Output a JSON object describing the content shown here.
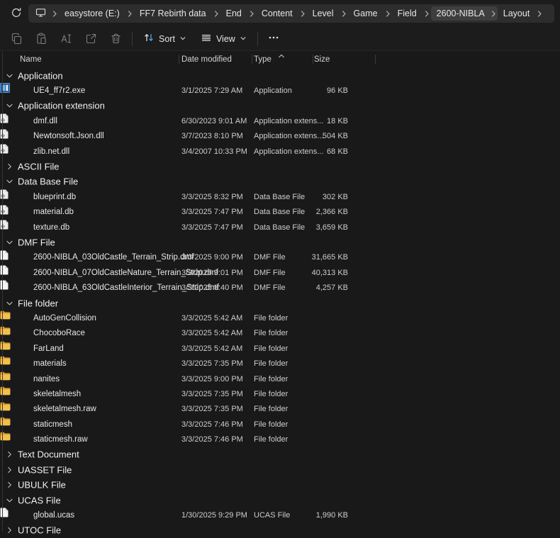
{
  "address_bar": {
    "refresh_icon": "refresh-icon",
    "device_icon": "monitor-icon",
    "breadcrumbs": [
      "easystore (E:)",
      "FF7 Rebirth data",
      "End",
      "Content",
      "Level",
      "Game",
      "Field",
      "2600-NIBLA",
      "Layout"
    ],
    "highlighted": "2600-NIBLA"
  },
  "toolbar": {
    "buttons": [
      {
        "icon": "copy-icon",
        "enabled": false
      },
      {
        "icon": "paste-icon",
        "enabled": false
      },
      {
        "icon": "rename-icon",
        "enabled": false
      },
      {
        "icon": "share-icon",
        "enabled": false
      },
      {
        "icon": "delete-icon",
        "enabled": false
      }
    ],
    "sort_label": "Sort",
    "view_label": "View",
    "more_icon": "more-options-icon"
  },
  "columns": {
    "name": "Name",
    "date_modified": "Date modified",
    "type": "Type",
    "size": "Size",
    "sorted_by": "Type",
    "sort_direction": "ascending"
  },
  "file_list": {
    "groups": [
      {
        "label": "Application",
        "expanded": true,
        "items": [
          {
            "icon": "application",
            "name": "UE4_ff7r2.exe",
            "date_modified": "3/1/2025 7:29 AM",
            "type": "Application",
            "size": "96 KB"
          }
        ]
      },
      {
        "label": "Application extension",
        "expanded": true,
        "items": [
          {
            "icon": "dll",
            "name": "dmf.dll",
            "date_modified": "6/30/2023 9:01 AM",
            "type": "Application extens...",
            "size": "18 KB"
          },
          {
            "icon": "dll",
            "name": "Newtonsoft.Json.dll",
            "date_modified": "3/7/2023 8:10 PM",
            "type": "Application extens...",
            "size": "504 KB"
          },
          {
            "icon": "dll",
            "name": "zlib.net.dll",
            "date_modified": "3/4/2007 10:33 PM",
            "type": "Application extens...",
            "size": "68 KB"
          }
        ]
      },
      {
        "label": "ASCII File",
        "expanded": false,
        "items": []
      },
      {
        "label": "Data Base File",
        "expanded": true,
        "items": [
          {
            "icon": "database",
            "name": "blueprint.db",
            "date_modified": "3/3/2025 8:32 PM",
            "type": "Data Base File",
            "size": "302 KB"
          },
          {
            "icon": "database",
            "name": "material.db",
            "date_modified": "3/3/2025 7:47 PM",
            "type": "Data Base File",
            "size": "2,366 KB"
          },
          {
            "icon": "database",
            "name": "texture.db",
            "date_modified": "3/3/2025 7:47 PM",
            "type": "Data Base File",
            "size": "3,659 KB"
          }
        ]
      },
      {
        "label": "DMF File",
        "expanded": true,
        "items": [
          {
            "icon": "file",
            "name": "2600-NIBLA_03OldCastle_Terrain_Strip.dmf",
            "date_modified": "3/3/2025 9:00 PM",
            "type": "DMF File",
            "size": "31,665 KB"
          },
          {
            "icon": "file",
            "name": "2600-NIBLA_07OldCastleNature_Terrain_Strip.dmf",
            "date_modified": "3/3/2025 9:01 PM",
            "type": "DMF File",
            "size": "40,313 KB"
          },
          {
            "icon": "file",
            "name": "2600-NIBLA_63OldCastleInterior_Terrain_Strip.dmf",
            "date_modified": "3/3/2025 8:40 PM",
            "type": "DMF File",
            "size": "4,257 KB"
          }
        ]
      },
      {
        "label": "File folder",
        "expanded": true,
        "items": [
          {
            "icon": "folder",
            "name": "AutoGenCollision",
            "date_modified": "3/3/2025 5:42 AM",
            "type": "File folder",
            "size": ""
          },
          {
            "icon": "folder",
            "name": "ChocoboRace",
            "date_modified": "3/3/2025 5:42 AM",
            "type": "File folder",
            "size": ""
          },
          {
            "icon": "folder",
            "name": "FarLand",
            "date_modified": "3/3/2025 5:42 AM",
            "type": "File folder",
            "size": ""
          },
          {
            "icon": "folder",
            "name": "materials",
            "date_modified": "3/3/2025 7:35 PM",
            "type": "File folder",
            "size": ""
          },
          {
            "icon": "folder",
            "name": "nanites",
            "date_modified": "3/3/2025 9:00 PM",
            "type": "File folder",
            "size": ""
          },
          {
            "icon": "folder",
            "name": "skeletalmesh",
            "date_modified": "3/3/2025 7:35 PM",
            "type": "File folder",
            "size": ""
          },
          {
            "icon": "folder",
            "name": "skeletalmesh.raw",
            "date_modified": "3/3/2025 7:35 PM",
            "type": "File folder",
            "size": ""
          },
          {
            "icon": "folder",
            "name": "staticmesh",
            "date_modified": "3/3/2025 7:46 PM",
            "type": "File folder",
            "size": ""
          },
          {
            "icon": "folder",
            "name": "staticmesh.raw",
            "date_modified": "3/3/2025 7:46 PM",
            "type": "File folder",
            "size": ""
          }
        ]
      },
      {
        "label": "Text Document",
        "expanded": false,
        "items": []
      },
      {
        "label": "UASSET File",
        "expanded": false,
        "items": []
      },
      {
        "label": "UBULK File",
        "expanded": false,
        "items": []
      },
      {
        "label": "UCAS File",
        "expanded": true,
        "items": [
          {
            "icon": "file",
            "name": "global.ucas",
            "date_modified": "1/30/2025 9:29 PM",
            "type": "UCAS File",
            "size": "1,990 KB"
          }
        ]
      },
      {
        "label": "UTOC File",
        "expanded": false,
        "partially_visible": true,
        "items": []
      }
    ]
  },
  "colors": {
    "background": "#191919",
    "address_bar": "#2d2d2d",
    "breadcrumb_highlight": "#3e3e3e",
    "folder_icon": "#f3c04b",
    "sort_arrow_accent": "#4fa3e8"
  }
}
